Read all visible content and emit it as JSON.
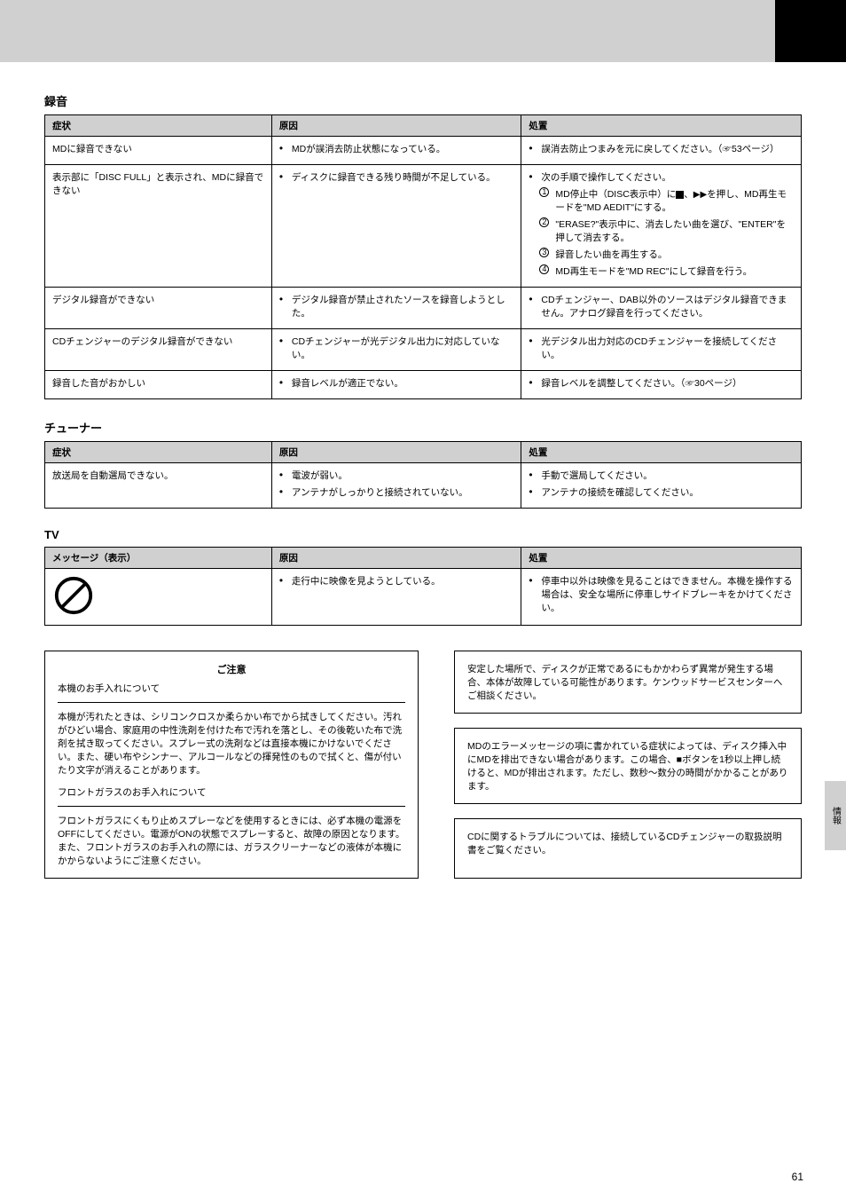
{
  "side_tab": "情報",
  "page_number": "61",
  "sections": {
    "recording": {
      "title": "録音",
      "headers": [
        "症状",
        "原因",
        "処置"
      ],
      "rows": [
        {
          "symptom": "MDに録音できない",
          "causes": [
            "MDが誤消去防止状態になっている。"
          ],
          "remedies": [
            {
              "type": "bullet",
              "text": "誤消去防止つまみを元に戻してください。（☞53ページ）"
            }
          ]
        },
        {
          "symptom": "表示部に「DISC FULL」と表示され、MDに録音できない",
          "causes": [
            "ディスクに録音できる残り時間が不足している。"
          ],
          "remedies": [
            {
              "type": "bullet",
              "text": "次の手順で操作してください。"
            },
            {
              "type": "step",
              "num": "1",
              "text": "MD停止中（DISC表示中）に■、▶▶を押し、MD再生モードを\"MD AEDIT\"にする。"
            },
            {
              "type": "step",
              "num": "2",
              "text": "\"ERASE?\"表示中に、消去したい曲を選び、\"ENTER\"を押して消去する。"
            },
            {
              "type": "step",
              "num": "3",
              "text": "録音したい曲を再生する。"
            },
            {
              "type": "step",
              "num": "4",
              "text": "MD再生モードを\"MD REC\"にして録音を行う。"
            }
          ]
        },
        {
          "symptom": "デジタル録音ができない",
          "causes": [
            "デジタル録音が禁止されたソースを録音しようとした。"
          ],
          "remedies": [
            {
              "type": "bullet",
              "text": "CDチェンジャー、DAB以外のソースはデジタル録音できません。アナログ録音を行ってください。"
            }
          ]
        },
        {
          "symptom": "CDチェンジャーのデジタル録音ができない",
          "causes": [
            "CDチェンジャーが光デジタル出力に対応していない。"
          ],
          "remedies": [
            {
              "type": "bullet",
              "text": "光デジタル出力対応のCDチェンジャーを接続してください。"
            }
          ]
        },
        {
          "symptom": "録音した音がおかしい",
          "causes": [
            "録音レベルが適正でない。"
          ],
          "remedies": [
            {
              "type": "bullet",
              "text": "録音レベルを調整してください。（☞30ページ）"
            }
          ]
        }
      ]
    },
    "tuner": {
      "title": "チューナー",
      "headers": [
        "症状",
        "原因",
        "処置"
      ],
      "rows": [
        {
          "symptom": "放送局を自動選局できない。",
          "causes": [
            "電波が弱い。",
            "アンテナがしっかりと接続されていない。"
          ],
          "remedies": [
            "手動で選局してください。",
            "アンテナの接続を確認してください。"
          ]
        }
      ]
    },
    "tv": {
      "title": "TV",
      "headers": [
        "メッセージ（表示）",
        "原因",
        "処置"
      ],
      "rows": [
        {
          "symptom_icon": true,
          "causes": [
            "走行中に映像を見ようとしている。"
          ],
          "remedies": [
            "停車中以外は映像を見ることはできません。本機を操作する場合は、安全な場所に停車しサイドブレーキをかけてください。"
          ]
        }
      ]
    }
  },
  "notes": {
    "left": {
      "title": "ご注意",
      "block1_heading": "本機のお手入れについて",
      "block1_text": "本機が汚れたときは、シリコンクロスか柔らかい布でから拭きしてください。汚れがひどい場合、家庭用の中性洗剤を付けた布で汚れを落とし、その後乾いた布で洗剤を拭き取ってください。スプレー式の洗剤などは直接本機にかけないでください。また、硬い布やシンナー、アルコールなどの揮発性のもので拭くと、傷が付いたり文字が消えることがあります。",
      "block2_heading": "フロントガラスのお手入れについて",
      "block2_text": "フロントガラスにくもり止めスプレーなどを使用するときには、必ず本機の電源をOFFにしてください。電源がONの状態でスプレーすると、故障の原因となります。また、フロントガラスのお手入れの際には、ガラスクリーナーなどの液体が本機にかからないようにご注意ください。"
    },
    "right": [
      "安定した場所で、ディスクが正常であるにもかかわらず異常が発生する場合、本体が故障している可能性があります。ケンウッドサービスセンターへご相談ください。",
      "MDのエラーメッセージの項に書かれている症状によっては、ディスク挿入中にMDを排出できない場合があります。この場合、■ボタンを1秒以上押し続けると、MDが排出されます。ただし、数秒～数分の時間がかかることがあります。",
      "CDに関するトラブルについては、接続しているCDチェンジャーの取扱説明書をご覧ください。"
    ]
  }
}
